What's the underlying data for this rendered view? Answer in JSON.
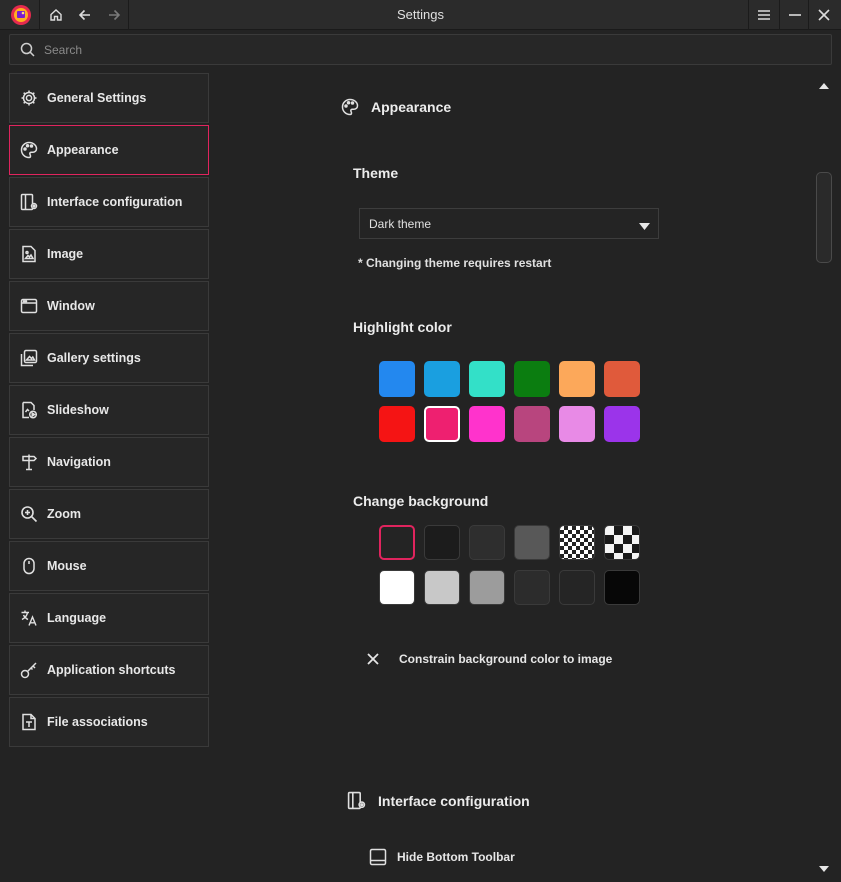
{
  "window": {
    "title": "Settings"
  },
  "search": {
    "placeholder": "Search"
  },
  "sidebar": {
    "items": [
      {
        "label": "General Settings",
        "icon": "gear-icon"
      },
      {
        "label": "Appearance",
        "icon": "palette-icon"
      },
      {
        "label": "Interface configuration",
        "icon": "interface-config-icon"
      },
      {
        "label": "Image",
        "icon": "image-icon"
      },
      {
        "label": "Window",
        "icon": "window-icon"
      },
      {
        "label": "Gallery settings",
        "icon": "gallery-icon"
      },
      {
        "label": "Slideshow",
        "icon": "slideshow-icon"
      },
      {
        "label": "Navigation",
        "icon": "signpost-icon"
      },
      {
        "label": "Zoom",
        "icon": "zoom-icon"
      },
      {
        "label": "Mouse",
        "icon": "mouse-icon"
      },
      {
        "label": "Language",
        "icon": "translate-icon"
      },
      {
        "label": "Application shortcuts",
        "icon": "key-icon"
      },
      {
        "label": "File associations",
        "icon": "file-icon"
      }
    ],
    "active_index": 1
  },
  "appearance": {
    "heading": "Appearance",
    "theme": {
      "label": "Theme",
      "selected": "Dark theme",
      "note": "* Changing theme requires restart"
    },
    "highlight": {
      "label": "Highlight color",
      "colors": [
        "#2388ef",
        "#1a9fe0",
        "#33e0c8",
        "#0b7d10",
        "#fca85a",
        "#e05a3b",
        "#f51414",
        "#ee2070",
        "#ff33cc",
        "#b8457e",
        "#e88ae6",
        "#9b34ea"
      ],
      "selected_index": 7
    },
    "background": {
      "label": "Change background",
      "colors": [
        "#242424",
        "#1c1c1c",
        "#2e2e2e",
        "#585858",
        "checker-small",
        "checker-large",
        "#ffffff",
        "#c8c8c8",
        "#9c9c9c",
        "#2c2c2c",
        "#252525",
        "#070707"
      ],
      "selected_index": 0
    },
    "constrain": {
      "label": "Constrain background color to image",
      "checked": false
    }
  },
  "interface": {
    "heading": "Interface configuration",
    "hide_toolbar": {
      "label": "Hide Bottom Toolbar"
    }
  },
  "colors": {
    "accent": "#e0245e"
  }
}
